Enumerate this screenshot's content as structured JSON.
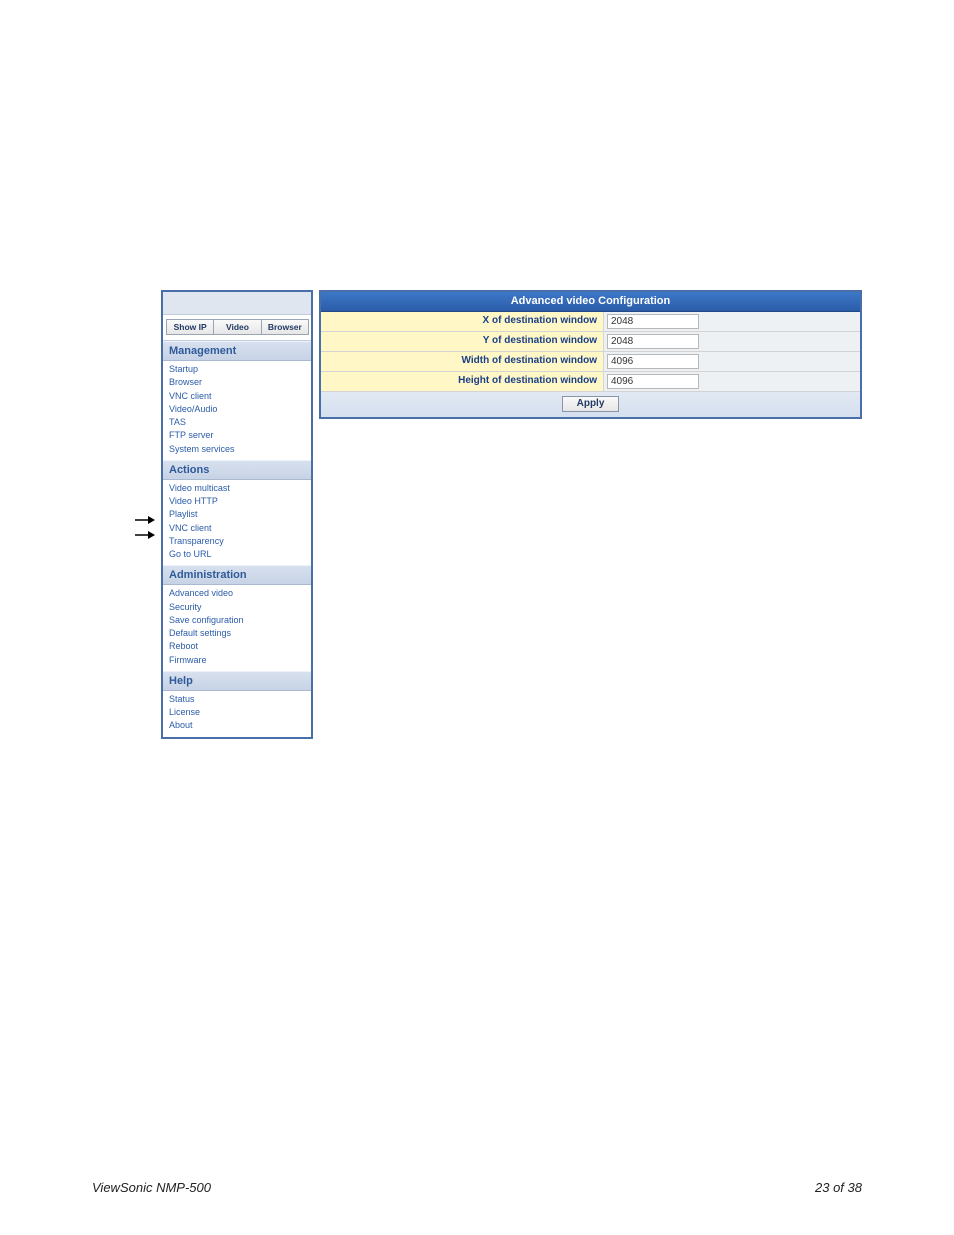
{
  "sidebar": {
    "buttons": {
      "show_ip": "Show IP",
      "video": "Video",
      "browser": "Browser"
    },
    "management_heading": "Management",
    "management": [
      "Startup",
      "Browser",
      "VNC client",
      "Video/Audio",
      "TAS",
      "FTP server",
      "System services"
    ],
    "actions_heading": "Actions",
    "actions": [
      "Video multicast",
      "Video HTTP",
      "Playlist",
      "VNC client",
      "Transparency",
      "Go to URL"
    ],
    "administration_heading": "Administration",
    "administration": [
      "Advanced video",
      "Security",
      "Save configuration",
      "Default settings",
      "Reboot",
      "Firmware"
    ],
    "help_heading": "Help",
    "help": [
      "Status",
      "License",
      "About"
    ]
  },
  "main": {
    "title": "Advanced video Configuration",
    "rows": [
      {
        "label": "X of destination window",
        "value": "2048"
      },
      {
        "label": "Y of destination window",
        "value": "2048"
      },
      {
        "label": "Width of destination window",
        "value": "4096"
      },
      {
        "label": "Height of destination window",
        "value": "4096"
      }
    ],
    "apply_label": "Apply"
  },
  "footer": {
    "left": "ViewSonic NMP-500",
    "right": "23 of  38"
  }
}
